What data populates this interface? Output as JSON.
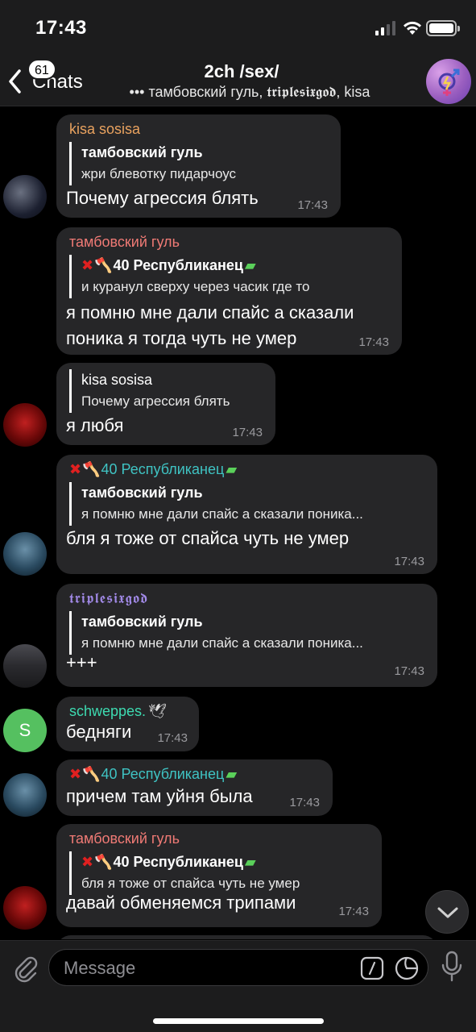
{
  "status": {
    "time": "17:43"
  },
  "header": {
    "back_label": "Chats",
    "unread_count": "61",
    "title": "2ch /sex/",
    "subtitle": "••• тамбовский гуль, 𝖙𝖗𝖎𝖕𝖑𝖊𝖘𝖎𝖝𝖌𝖔𝖉, kisa"
  },
  "colors": {
    "accent_green": "#3ddbb1",
    "orange": "#e9a25f",
    "pink": "#ef7a75",
    "purple": "#a28ae8",
    "teal": "#3fc3c3"
  },
  "messages": [
    {
      "sender": "kisa sosisa",
      "reply_name": "тамбовский гуль",
      "reply_text": "жри блевотку пидарчоус",
      "text": "Почему агрессия блять",
      "time": "17:43"
    },
    {
      "sender": "тамбовский гуль",
      "reply_name": "40 Республиканец",
      "reply_text": "и куранул сверху через часик где то",
      "text1": "я помню мне дали спайс а сказали",
      "text2": "поника я тогда чуть не умер",
      "time": "17:43"
    },
    {
      "reply_name": "kisa sosisa",
      "reply_text": "Почему агрессия блять",
      "text": "я любя",
      "time": "17:43"
    },
    {
      "sender": "40 Республиканец",
      "reply_name": "тамбовский гуль",
      "reply_text": "я помню мне дали спайс а сказали поника...",
      "text": "бля я тоже от спайса чуть не умер",
      "time": "17:43"
    },
    {
      "sender": "𝖙𝖗𝖎𝖕𝖑𝖊𝖘𝖎𝖝𝖌𝖔𝖉",
      "reply_name": "тамбовский гуль",
      "reply_text": "я помню мне дали спайс а сказали поника...",
      "text": "+++",
      "time": "17:43"
    },
    {
      "sender": "schweppes.",
      "avatar_letter": "S",
      "text": "бедняги",
      "time": "17:43"
    },
    {
      "sender": "40 Республиканец",
      "text": "причем там уйня была",
      "time": "17:43"
    },
    {
      "sender": "тамбовский гуль",
      "reply_name": "40 Республиканец",
      "reply_text": "бля я тоже от спайса чуть не умер",
      "text": "давай обменяемся трипами",
      "time": "17:43"
    }
  ],
  "input": {
    "placeholder": "Message"
  }
}
